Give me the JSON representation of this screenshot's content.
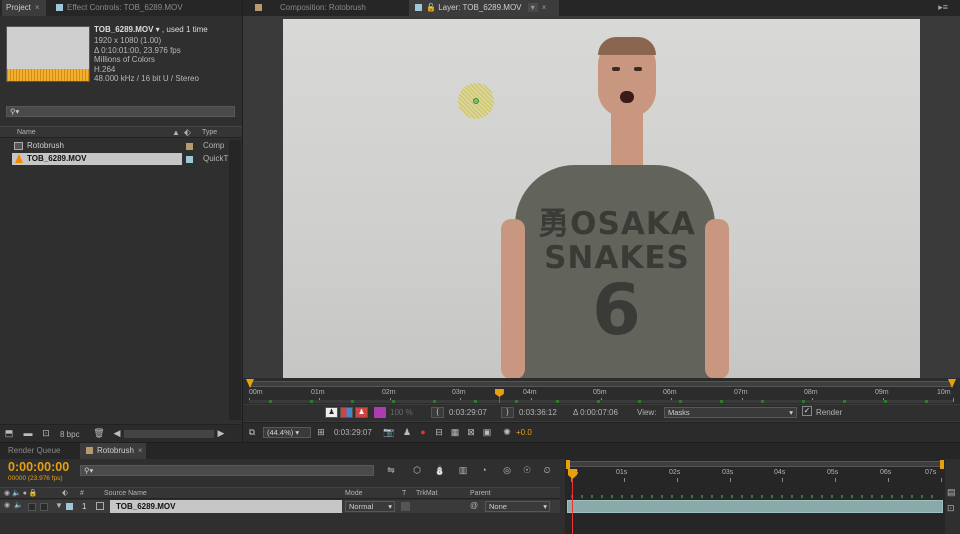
{
  "project_panel": {
    "tabs": [
      {
        "label": "Project",
        "active": true,
        "close": "×"
      },
      {
        "label": "Effect Controls: TOB_6289.MOV",
        "active": false
      }
    ],
    "item_name": "TOB_6289.MOV",
    "item_used": ", used 1 time",
    "info": [
      "1920 x 1080 (1.00)",
      "Δ 0:10:01:00, 23.976 fps",
      "Millions of Colors",
      "H.264",
      "48.000 kHz / 16 bit U / Stereo"
    ],
    "search_icon": "⚲▾",
    "columns": {
      "name": "Name",
      "type": "Type"
    },
    "items": [
      {
        "name": "Rotobrush",
        "type": "Comp",
        "icon": "composition-icon",
        "color": "#b89a70"
      },
      {
        "name": "TOB_6289.MOV",
        "type": "QuickT",
        "icon": "vlc-cone-icon",
        "color": "#9ec8d8",
        "selected": true
      }
    ],
    "footer": {
      "bpc": "8 bpc"
    }
  },
  "viewer": {
    "tabs": [
      {
        "label": "Composition: Rotobrush",
        "active": false
      },
      {
        "label": "Layer: TOB_6289.MOV",
        "active": true
      }
    ],
    "ruler_labels": [
      "00m",
      "01m",
      "02m",
      "03m",
      "04m",
      "05m",
      "06m",
      "07m",
      "08m",
      "09m",
      "10m"
    ],
    "playhead_fraction": 0.355,
    "row1": {
      "opacity": "100 %",
      "in_point": "0:03:29:07",
      "out_point": "0:03:36:12",
      "duration": "Δ 0:00:07:06",
      "view_label": "View:",
      "view_value": "Masks",
      "render_label": "Render"
    },
    "row2": {
      "zoom": "(44.4%)",
      "time": "0:03:29:07",
      "exposure": "+0.0"
    },
    "shirt_lines": [
      "勇OSAKA",
      "SNAKES",
      "6"
    ]
  },
  "timeline": {
    "tabs": [
      {
        "label": "Render Queue",
        "active": false
      },
      {
        "label": "Rotobrush",
        "active": true
      }
    ],
    "timecode": "0:00:00:00",
    "frames": "00000 (23.976 fps)",
    "search_icon": "⚲▾",
    "columns": {
      "num": "#",
      "source": "Source Name",
      "mode": "Mode",
      "t": "T",
      "trkmat": "TrkMat",
      "parent": "Parent"
    },
    "layer": {
      "num": "1",
      "name": "TOB_6289.MOV",
      "mode": "Normal",
      "parent": "None"
    },
    "ruler_labels": [
      "0s",
      "01s",
      "02s",
      "03s",
      "04s",
      "05s",
      "06s",
      "07s"
    ]
  },
  "colors": {
    "accent": "#e8a010",
    "panel": "#2f2f2f",
    "label_aqua": "#9ec8d8",
    "label_tan": "#b89a70",
    "track_bar": "#8aa9a9"
  }
}
